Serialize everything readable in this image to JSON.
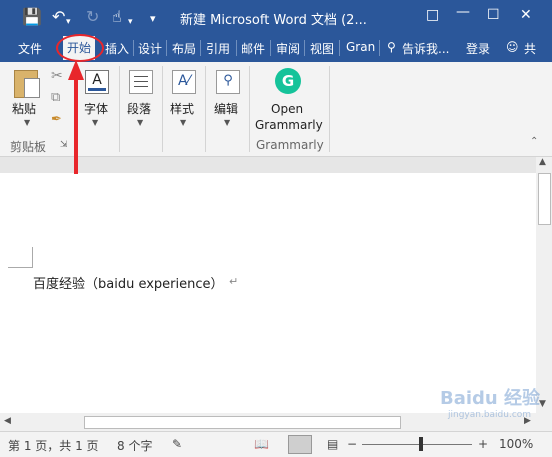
{
  "titlebar": {
    "title": "新建 Microsoft Word 文档 (2...",
    "bg_color": "#2b579a"
  },
  "tabs": {
    "file": "文件",
    "home": "开始",
    "insert": "插入",
    "design": "设计",
    "layout": "布局",
    "references": "引用",
    "mailings": "邮件",
    "review": "审阅",
    "view": "视图",
    "grammarly": "Gran",
    "tell_me": "告诉我...",
    "login": "登录",
    "share": "共"
  },
  "ribbon": {
    "paste": "粘贴",
    "clipboard": "剪贴板",
    "font": "字体",
    "paragraph": "段落",
    "styles": "样式",
    "editing": "编辑",
    "open_grammarly_line1": "Open",
    "open_grammarly_line2": "Grammarly",
    "grammarly_group": "Grammarly",
    "grammarly_color": "#15c39a"
  },
  "document": {
    "text": "百度经验（baidu experience）"
  },
  "status": {
    "page": "第 1 页，共 1 页",
    "words": "8 个字",
    "zoom": "100%"
  },
  "annotation": {
    "color": "#e8262b"
  },
  "watermark": {
    "text": "Baidu 经验",
    "url": "jingyan.baidu.com"
  }
}
